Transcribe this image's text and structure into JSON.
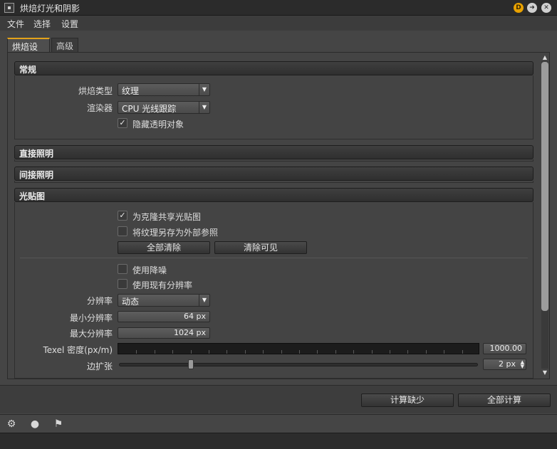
{
  "window": {
    "title": "烘焙灯光和阴影",
    "d_badge": "D",
    "arrow_glyph": "➜",
    "close_glyph": "✕"
  },
  "menu": {
    "file": "文件",
    "select": "选择",
    "settings": "设置"
  },
  "tabs": {
    "bake_settings": "烘焙设置",
    "advanced": "高级"
  },
  "sections": {
    "general": "常规",
    "direct": "直接照明",
    "indirect": "间接照明",
    "lightmap": "光贴图"
  },
  "general": {
    "bake_type_label": "烘焙类型",
    "bake_type_value": "纹理",
    "renderer_label": "渲染器",
    "renderer_value": "CPU 光线跟踪",
    "hide_transparent_label": "隐藏透明对象",
    "hide_transparent_checked": "✓"
  },
  "lightmap": {
    "share_clone_label": "为克隆共享光贴图",
    "share_clone_checked": "✓",
    "save_external_label": "将纹理另存为外部参照",
    "save_external_checked": "",
    "clear_all_label": "全部清除",
    "clear_visible_label": "清除可见",
    "use_denoise_label": "使用降噪",
    "use_denoise_checked": "",
    "use_existing_res_label": "使用现有分辨率",
    "use_existing_res_checked": "",
    "resolution_label": "分辨率",
    "resolution_value": "动态",
    "min_res_label": "最小分辨率",
    "min_res_value": "64 px",
    "max_res_label": "最大分辨率",
    "max_res_value": "1024 px",
    "texel_label": "Texel 密度(px/m)",
    "texel_value": "1000.00",
    "margin_label": "边扩张",
    "margin_value": "2 px",
    "margin_slider_fraction": 0.2
  },
  "actions": {
    "compute_missing": "计算缺少",
    "compute_all": "全部计算"
  },
  "icons": {
    "dropdown_arrow": "▼",
    "spin_up": "▲",
    "spin_down": "▼",
    "scroll_up": "▲",
    "scroll_down": "▼",
    "tool1": "⚙",
    "tool2": "●",
    "tool3": "⚑"
  },
  "colors": {
    "accent": "#e3a21a",
    "background": "#454545",
    "title_bar": "#2b2b2b"
  }
}
